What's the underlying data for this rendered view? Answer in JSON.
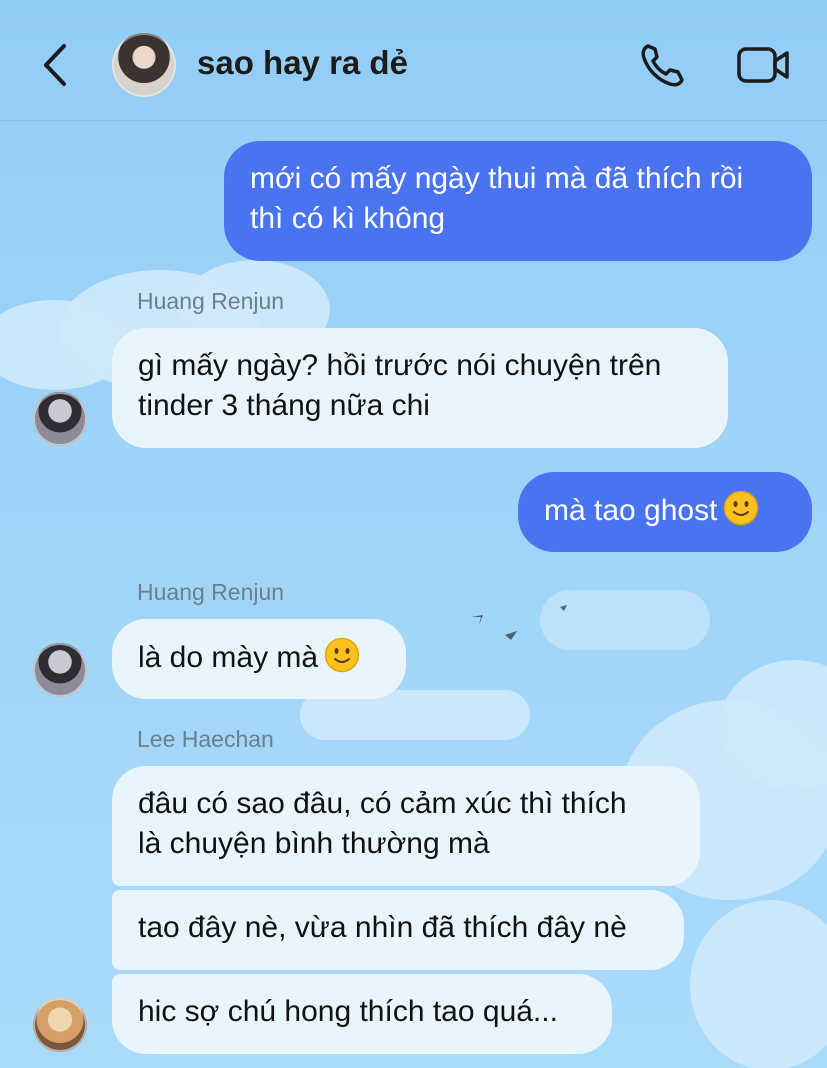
{
  "header": {
    "title": "sao hay ra dẻ",
    "icons": {
      "back": "chevron-left-icon",
      "call": "phone-icon",
      "video": "video-camera-icon"
    }
  },
  "messages": [
    {
      "type": "outgoing",
      "lines": [
        "mới có mấy ngày thui mà đã thích rồi",
        "thì có kì không"
      ]
    },
    {
      "type": "incoming",
      "sender": "Huang Renjun",
      "lines": [
        "gì mấy ngày? hồi trước nói chuyện trên",
        "tinder 3 tháng nữa chi"
      ]
    },
    {
      "type": "outgoing",
      "text": "mà tao ghost",
      "emoji": "slightly-smiling-face-icon"
    },
    {
      "type": "incoming",
      "sender": "Huang Renjun",
      "text": "là do mày mà",
      "emoji": "slightly-smiling-face-icon"
    },
    {
      "type": "incoming",
      "sender": "Lee Haechan",
      "lines": [
        "đâu có sao đâu, có cảm xúc thì thích",
        "là chuyện bình thường mà"
      ]
    },
    {
      "type": "incoming",
      "sender": "Lee Haechan",
      "text": "tao đây nè, vừa nhìn đã thích đây nè"
    },
    {
      "type": "incoming",
      "sender": "Lee Haechan",
      "text": "hic sợ chú hong thích tao quá..."
    }
  ],
  "colors": {
    "outgoing_bubble": "#4a73f2",
    "incoming_bubble": "#e8f5fd",
    "background": "#9fd4f8"
  }
}
